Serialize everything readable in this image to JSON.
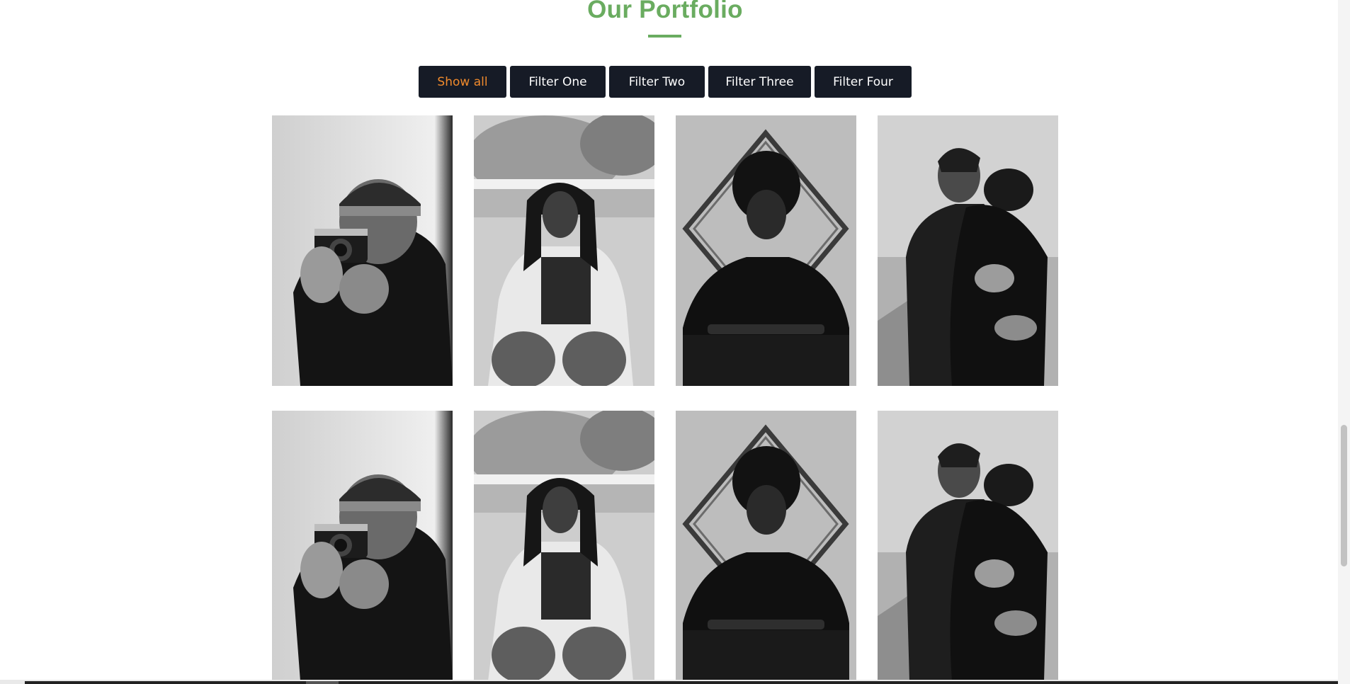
{
  "section": {
    "title": "Our Portfolio",
    "accent_color": "#6aac60"
  },
  "filters": {
    "active_color": "#f08a2c",
    "items": [
      {
        "label": "Show all",
        "active": true
      },
      {
        "label": "Filter One",
        "active": false
      },
      {
        "label": "Filter Two",
        "active": false
      },
      {
        "label": "Filter Three",
        "active": false
      },
      {
        "label": "Filter Four",
        "active": false
      }
    ]
  },
  "portfolio": {
    "items": [
      {
        "photo": "man-with-camera-photo"
      },
      {
        "photo": "woman-with-braids-photo"
      },
      {
        "photo": "woman-with-frame-photo"
      },
      {
        "photo": "couple-embracing-photo"
      },
      {
        "photo": "man-with-camera-photo"
      },
      {
        "photo": "woman-with-braids-photo"
      },
      {
        "photo": "woman-with-frame-photo"
      },
      {
        "photo": "couple-embracing-photo"
      }
    ]
  }
}
